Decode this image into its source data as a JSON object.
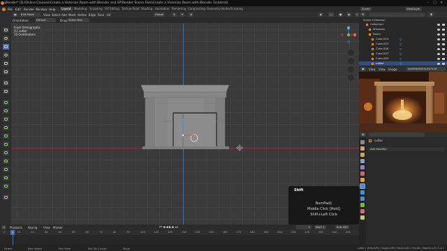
{
  "titlebar": {
    "title": "Blender* [D:\\Online Courses\\Create a Victorian Room with Blender and SP\\Render Scene Files\\Create a Victorian Room with Blender 3d.blend]",
    "logo_color": "#e87d0d"
  },
  "menu": {
    "items": [
      "File",
      "Edit",
      "Render",
      "Window",
      "Help"
    ]
  },
  "workspaces": {
    "tabs": [
      "Layout",
      "Modeling",
      "Sculpting",
      "UV Editing",
      "Texture Paint",
      "Shading",
      "Animation",
      "Rendering",
      "Compositing",
      "Geometry Nodes",
      "Scripting"
    ],
    "active_index": 0
  },
  "scene": {
    "scene_icon": "scene-icon",
    "scene_name": "Scene",
    "view_layer_icon": "view-layer-icon",
    "view_layer_name": "ViewLayer"
  },
  "viewport_header": {
    "mode": "Edit Mode",
    "menus": [
      "View",
      "Select",
      "Add",
      "Mesh",
      "Vertex",
      "Edge",
      "Face",
      "UV"
    ],
    "orientation_label": "Global"
  },
  "viewport_subheader": {
    "orientation_caption": "Orientation:",
    "orientation_value": "Default",
    "drag_caption": "Drag:",
    "drag_value": "Select Box"
  },
  "viewport": {
    "info_lines": [
      "Front Orthographic",
      "(1) cutter",
      "10 Centimeters"
    ],
    "gizmo_axes": [
      "X",
      "Y",
      "Z"
    ],
    "accent_x": "#e0464c",
    "accent_z": "#4a8dd4",
    "accent_y": "#7ab53b"
  },
  "shift_panel": {
    "title": "Shift",
    "keys": [
      "NumPad1",
      "Middle Click [Hold]",
      "Shift+Left Click"
    ]
  },
  "timeline": {
    "menus": [
      "Playback",
      "Keying",
      "View",
      "Marker"
    ],
    "ticks": [
      "0",
      "10",
      "20",
      "30",
      "40",
      "50",
      "60",
      "70",
      "80",
      "90",
      "100",
      "110",
      "120",
      "130",
      "140",
      "150",
      "160",
      "170",
      "180",
      "190",
      "200",
      "210",
      "220",
      "230",
      "240",
      "250"
    ],
    "current_frame": "1",
    "frame_display": "1",
    "start_label": "Start",
    "start_value": "1",
    "end_label": "End",
    "end_value": "250"
  },
  "statusbar": {
    "items": [
      "Select",
      "Box Select",
      "Pan View",
      "Set 3D Cursor",
      "Move"
    ],
    "stats": "cutter | Verts:6/52 | Edges:2/95 | Faces:0/42 | Tris:80 | Objects:1/8 | 3.4.1"
  },
  "outliner": {
    "header": "Scene Collection",
    "rows": [
      {
        "label": "Collection"
      },
      {
        "label": "Windows"
      },
      {
        "label": "Room"
      },
      {
        "label": "Cube.004"
      },
      {
        "label": "Cube.003"
      },
      {
        "label": "Cube.006"
      },
      {
        "label": "Cube.007"
      },
      {
        "label": "Cube.009"
      },
      {
        "label": "cutter"
      }
    ],
    "selected_index": 8,
    "icon_color": "#e49b3b",
    "modifier_color": "#6fbfe8"
  },
  "image_editor": {
    "menus": [
      "View",
      "View",
      "Image"
    ],
    "image_name": "fpk999c8503c3e7139"
  },
  "properties": {
    "object_name": "cutter",
    "add_modifier_label": "Add Modifier"
  }
}
